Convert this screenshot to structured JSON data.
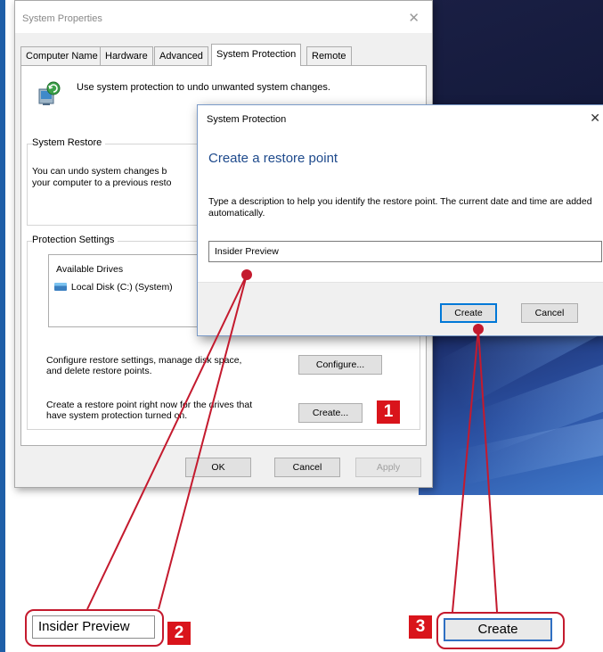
{
  "system_properties": {
    "title": "System Properties",
    "tabs": [
      "Computer Name",
      "Hardware",
      "Advanced",
      "System Protection",
      "Remote"
    ],
    "active_tab": "System Protection",
    "intro": "Use system protection to undo unwanted system changes.",
    "system_restore": {
      "label": "System Restore",
      "text_line1": "You can undo system changes b",
      "text_line2": "your computer to a previous resto"
    },
    "protection_settings": {
      "label": "Protection Settings",
      "column_header": "Available Drives",
      "drive": "Local Disk (C:) (System)"
    },
    "configure_text_line1": "Configure restore settings, manage disk space,",
    "configure_text_line2": "and delete restore points.",
    "configure_button": "Configure...",
    "create_text_line1": "Create a restore point right now for the drives that",
    "create_text_line2": "have system protection turned on.",
    "create_button": "Create...",
    "ok_button": "OK",
    "cancel_button": "Cancel",
    "apply_button": "Apply"
  },
  "protection_dialog": {
    "title": "System Protection",
    "heading": "Create a restore point",
    "description": "Type a description to help you identify the restore point. The current date and time are added automatically.",
    "input_value": "Insider Preview",
    "create_button": "Create",
    "cancel_button": "Cancel"
  },
  "callouts": {
    "step1": "1",
    "step2": "2",
    "step3": "3",
    "zoom_input_text": "Insider Preview",
    "zoom_button_text": "Create",
    "accent_color": "#d9141b"
  }
}
